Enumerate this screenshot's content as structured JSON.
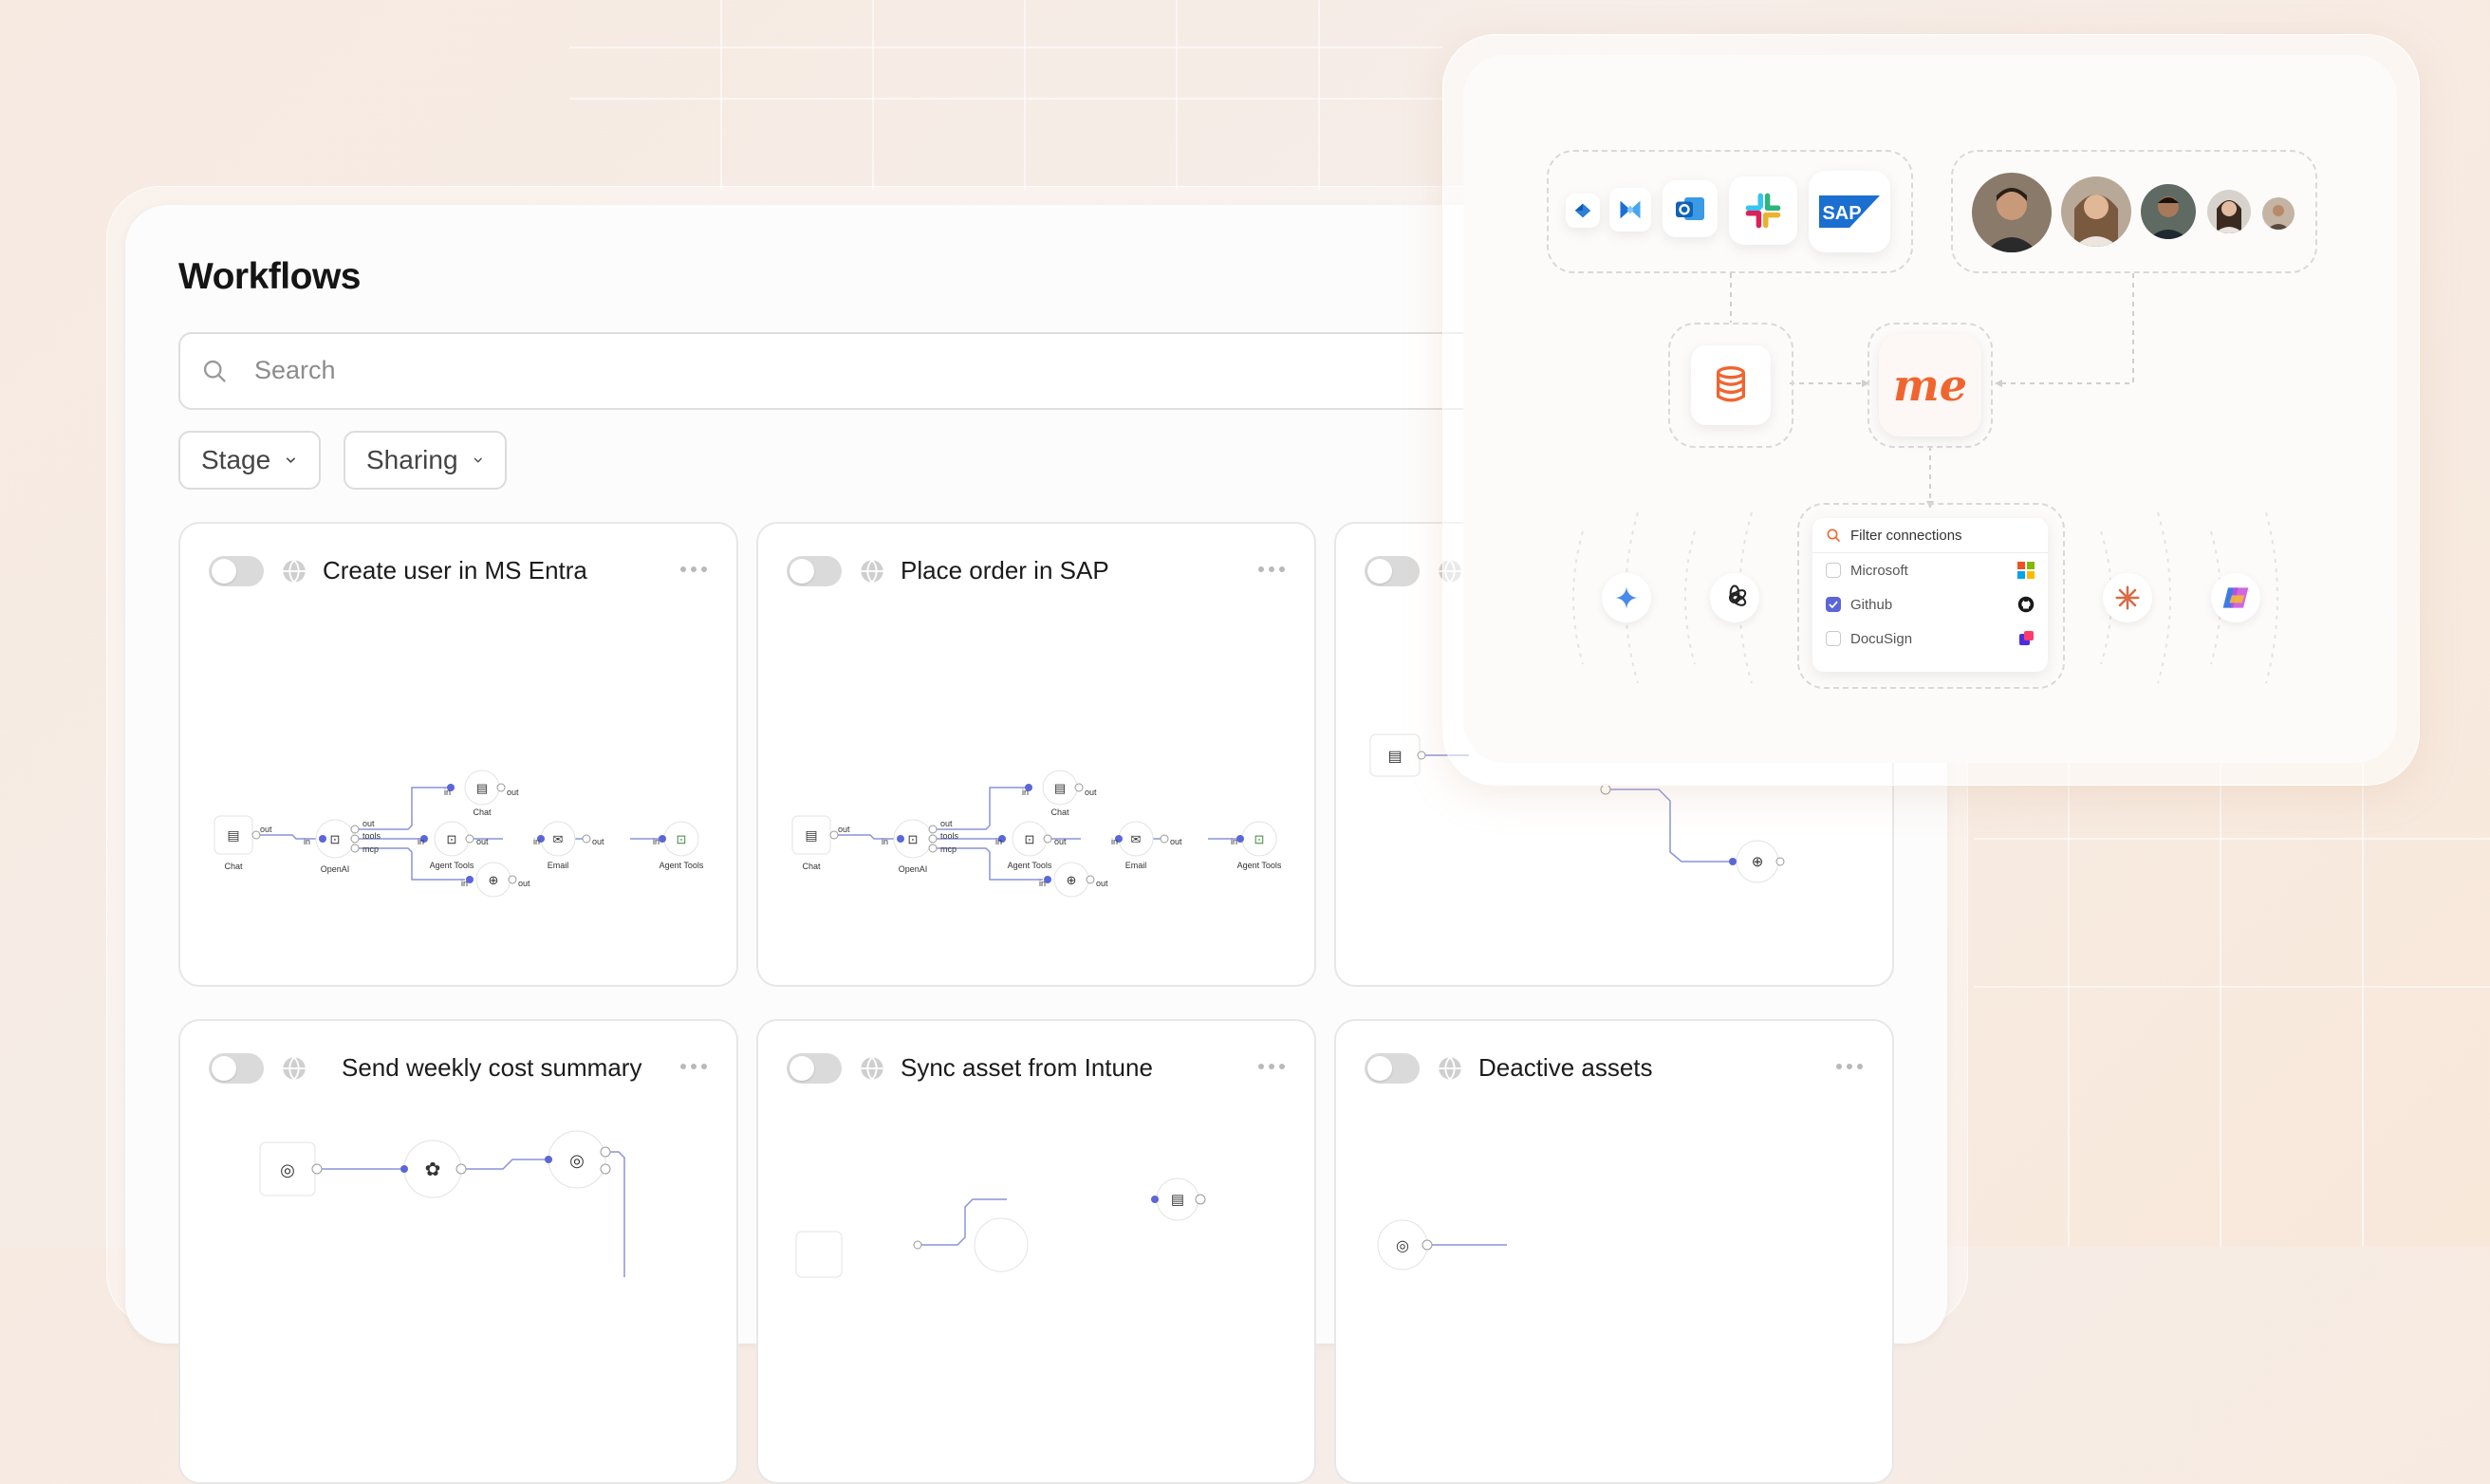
{
  "page": {
    "title": "Workflows",
    "search_placeholder": "Search"
  },
  "filters": [
    {
      "label": "Stage"
    },
    {
      "label": "Sharing"
    }
  ],
  "cards": [
    {
      "title": "Create user in MS Entra",
      "enabled": false
    },
    {
      "title": "Place order in SAP",
      "enabled": false
    },
    {
      "title": "",
      "enabled": false
    },
    {
      "title": "Send weekly cost summary",
      "enabled": false
    },
    {
      "title": "Sync asset from Intune",
      "enabled": false
    },
    {
      "title": "Deactive assets",
      "enabled": false
    }
  ],
  "diagram_labels": {
    "chat": "Chat",
    "openai": "OpenAI",
    "agent_tools": "Agent Tools",
    "email": "Email",
    "in": "in",
    "out": "out",
    "tools": "tools",
    "mcp": "mcp"
  },
  "integrations": {
    "apps": [
      "power-automate-icon",
      "microsoft-entra-icon",
      "outlook-icon",
      "slack-icon",
      "sap-icon"
    ],
    "sap_label": "SAP",
    "hub_logo": "me",
    "filter": {
      "placeholder": "Filter connections",
      "items": [
        {
          "label": "Microsoft",
          "checked": false
        },
        {
          "label": "Github",
          "checked": true
        },
        {
          "label": "DocuSign",
          "checked": false
        }
      ]
    },
    "ai_providers": [
      "gemini-icon",
      "openai-icon",
      "claude-icon",
      "copilot-icon"
    ]
  },
  "colors": {
    "accent": "#5b67d8",
    "brand": "#f0652f",
    "node_link": "#8a93d8"
  }
}
